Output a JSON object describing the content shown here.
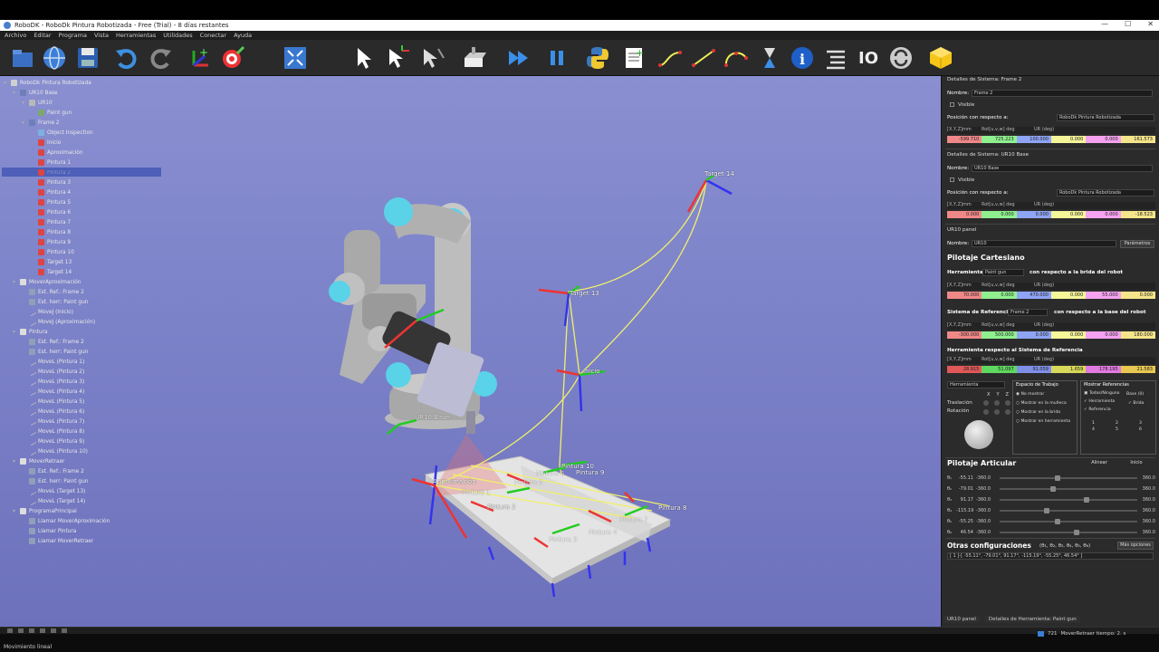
{
  "window": {
    "title": "RoboDK - RoboDk Pintura Robotizada - Free (Trial) - 8 días restantes",
    "controls": [
      "—",
      "☐",
      "✕"
    ]
  },
  "menu": [
    "Archivo",
    "Editar",
    "Programa",
    "Vista",
    "Herramientas",
    "Utilidades",
    "Conectar",
    "Ayuda"
  ],
  "toolbar": {
    "icons": [
      "open-icon",
      "globe-icon",
      "save-icon",
      "undo-icon",
      "redo-icon",
      "add-frame-icon",
      "add-target-icon",
      "fit-view-icon",
      "select-icon",
      "move-ref-icon",
      "move-tool-icon",
      "add-object-icon",
      "run-fast-icon",
      "pause-icon",
      "python-icon",
      "add-program-icon",
      "move-joint-icon",
      "move-linear-icon",
      "move-circular-icon",
      "pause-instruction-icon",
      "info-icon",
      "list-icon",
      "io-icon",
      "refresh-icon",
      "cube-icon"
    ],
    "io_label": "IO"
  },
  "tree": [
    {
      "label": "RoboDk Pintura Robotizada",
      "icon": "station",
      "level": 0,
      "twisty": "▾"
    },
    {
      "label": "UR10 Base",
      "icon": "frame",
      "level": 1,
      "twisty": "▾"
    },
    {
      "label": "UR10",
      "icon": "robot",
      "level": 2,
      "twisty": "▾"
    },
    {
      "label": "Paint gun",
      "icon": "tool",
      "level": 3,
      "twisty": ""
    },
    {
      "label": "Frame 2",
      "icon": "frame",
      "level": 2,
      "twisty": "▾"
    },
    {
      "label": "Object Inspection",
      "icon": "object",
      "level": 3,
      "twisty": ""
    },
    {
      "label": "Inicio",
      "icon": "target",
      "level": 3,
      "twisty": ""
    },
    {
      "label": "Aproximación",
      "icon": "target",
      "level": 3,
      "twisty": ""
    },
    {
      "label": "Pintura 1",
      "icon": "target",
      "level": 3,
      "twisty": ""
    },
    {
      "label": "Pintura 2",
      "icon": "target",
      "level": 3,
      "twisty": ""
    },
    {
      "label": "Pintura 3",
      "icon": "target",
      "level": 3,
      "twisty": ""
    },
    {
      "label": "Pintura 4",
      "icon": "target",
      "level": 3,
      "twisty": ""
    },
    {
      "label": "Pintura 5",
      "icon": "target",
      "level": 3,
      "twisty": ""
    },
    {
      "label": "Pintura 6",
      "icon": "target",
      "level": 3,
      "twisty": ""
    },
    {
      "label": "Pintura 7",
      "icon": "target",
      "level": 3,
      "twisty": ""
    },
    {
      "label": "Pintura 8",
      "icon": "target",
      "level": 3,
      "twisty": ""
    },
    {
      "label": "Pintura 9",
      "icon": "target",
      "level": 3,
      "twisty": ""
    },
    {
      "label": "Pintura 10",
      "icon": "target",
      "level": 3,
      "twisty": ""
    },
    {
      "label": "Target 13",
      "icon": "target",
      "level": 3,
      "twisty": ""
    },
    {
      "label": "Target 14",
      "icon": "target",
      "level": 3,
      "twisty": ""
    },
    {
      "label": "MoverAproximación",
      "icon": "prog",
      "level": 1,
      "twisty": "▾"
    },
    {
      "label": "Est. Ref.: Frame 2",
      "icon": "instr",
      "level": 2,
      "twisty": ""
    },
    {
      "label": "Est. herr: Paint gun",
      "icon": "instr",
      "level": 2,
      "twisty": ""
    },
    {
      "label": "MoveJ (Inicio)",
      "icon": "move",
      "level": 2,
      "twisty": ""
    },
    {
      "label": "MoveJ (Aproximación)",
      "icon": "move",
      "level": 2,
      "twisty": ""
    },
    {
      "label": "Pintura",
      "icon": "prog",
      "level": 1,
      "twisty": "▾"
    },
    {
      "label": "Est. Ref.: Frame 2",
      "icon": "instr",
      "level": 2,
      "twisty": ""
    },
    {
      "label": "Est. herr: Paint gun",
      "icon": "instr",
      "level": 2,
      "twisty": ""
    },
    {
      "label": "MoveL (Pintura 1)",
      "icon": "move",
      "level": 2,
      "twisty": ""
    },
    {
      "label": "MoveL (Pintura 2)",
      "icon": "move",
      "level": 2,
      "twisty": ""
    },
    {
      "label": "MoveL (Pintura 3)",
      "icon": "move",
      "level": 2,
      "twisty": ""
    },
    {
      "label": "MoveL (Pintura 4)",
      "icon": "move",
      "level": 2,
      "twisty": ""
    },
    {
      "label": "MoveL (Pintura 5)",
      "icon": "move",
      "level": 2,
      "twisty": ""
    },
    {
      "label": "MoveL (Pintura 6)",
      "icon": "move",
      "level": 2,
      "twisty": ""
    },
    {
      "label": "MoveL (Pintura 7)",
      "icon": "move",
      "level": 2,
      "twisty": ""
    },
    {
      "label": "MoveL (Pintura 8)",
      "icon": "move",
      "level": 2,
      "twisty": ""
    },
    {
      "label": "MoveL (Pintura 9)",
      "icon": "move",
      "level": 2,
      "twisty": ""
    },
    {
      "label": "MoveL (Pintura 10)",
      "icon": "move",
      "level": 2,
      "twisty": ""
    },
    {
      "label": "MoverRetraer",
      "icon": "prog",
      "level": 1,
      "twisty": "▾"
    },
    {
      "label": "Est. Ref.: Frame 2",
      "icon": "instr",
      "level": 2,
      "twisty": ""
    },
    {
      "label": "Est. herr: Paint gun",
      "icon": "instr",
      "level": 2,
      "twisty": ""
    },
    {
      "label": "MoveL (Target 13)",
      "icon": "move",
      "level": 2,
      "twisty": ""
    },
    {
      "label": "MoveL (Target 14)",
      "icon": "move",
      "level": 2,
      "twisty": ""
    },
    {
      "label": "ProgramaPrincipal",
      "icon": "prog",
      "level": 1,
      "twisty": "▾"
    },
    {
      "label": "Llamar MoverAproximación",
      "icon": "instr",
      "level": 2,
      "twisty": ""
    },
    {
      "label": "Llamar Pintura",
      "icon": "instr",
      "level": 2,
      "twisty": ""
    },
    {
      "label": "Llamar MoverRetraer",
      "icon": "instr",
      "level": 2,
      "twisty": ""
    }
  ],
  "viewport": {
    "labels": {
      "target14": "Target 14",
      "target13": "Target 13",
      "inicio": "Inicio",
      "pintura10": "Pintura 10",
      "pintura9": "Pintura 9",
      "pintura8": "Pintura 8",
      "pintura7": "Pintura 7",
      "pintura6": "Pintura 6",
      "pintura5": "Pintura 5",
      "pintura4": "Pintura 4",
      "pintura3": "Pintura 3",
      "pintura2": "Pintura 2",
      "pintura1": "Pintura 1",
      "aproximacion": "Aproximación",
      "ur10base": "UR10 Base"
    }
  },
  "right_panel": {
    "frame_details": {
      "header": "Detalles de Sistema: Frame 2",
      "name_label": "Nombre:",
      "name_value": "Frame 2",
      "visible_label": "Visible",
      "pos_label": "Posición con respecto a:",
      "ref_value": "RoboDk Pintura Robotizada",
      "pose_header": [
        "[X,Y,Z]mm",
        "Rot[u,v,w] deg",
        "UR (deg)"
      ],
      "pose": [
        "-599.710",
        "725.223",
        "100.000",
        "0.000",
        "0.000",
        "161.573"
      ]
    },
    "base_details": {
      "header": "Detalles de Sistema: UR10 Base",
      "name_label": "Nombre:",
      "name_value": "UR10 Base",
      "visible_label": "Visible",
      "pos_label": "Posición con respecto a:",
      "ref_value": "RoboDk Pintura Robotizada",
      "pose_header": [
        "[X,Y,Z]mm",
        "Rot[u,v,w] deg",
        "UR (deg)"
      ],
      "pose": [
        "0.000",
        "0.000",
        "0.000",
        "0.000",
        "0.000",
        "-18.523"
      ]
    },
    "robot_panel": {
      "header": "UR10 panel",
      "name_label": "Nombre:",
      "name_value": "UR10",
      "params_button": "Parámetros",
      "cartesian_title": "Pilotaje Cartesiano",
      "tool_label": "Herramienta",
      "tool_value": "Paint gun",
      "tool_rel": "con respecto a la brida del robot",
      "tool_pose": [
        "70.000",
        "0.000",
        "470.000",
        "0.000",
        "55.000",
        "0.000"
      ],
      "ref_label": "Sistema de Referencia",
      "ref_value": "Frame 2",
      "ref_rel": "con respecto a la base del robot",
      "ref_pose": [
        "-300.000",
        "500.000",
        "0.000",
        "0.000",
        "0.000",
        "180.000"
      ],
      "tool_ref_label": "Herramienta respecto al Sistema de Referencia",
      "tool_ref_pose": [
        "28.915",
        "51.097",
        "91.059",
        "1.659",
        "178.195",
        "21.583"
      ],
      "jog_label": "Herramienta",
      "translation_label": "Traslación",
      "rotation_label": "Rotación",
      "axes": [
        "X",
        "Y",
        "Z"
      ],
      "workspace_title": "Espacio de Trabajo",
      "workspace_opts": [
        "No mostrar",
        "Mostrar en la muñeca",
        "Mostrar en la brida",
        "Mostrar en herramienta"
      ],
      "show_refs_title": "Mostrar Referencias",
      "show_refs_opts": [
        "Todos/Ninguno",
        "Herramienta",
        "Referencia"
      ],
      "base_label": "Base (0)",
      "brida_label": "Brida",
      "joint_numbers": [
        "1",
        "2",
        "3",
        "4",
        "5",
        "6"
      ],
      "joint_title": "Pilotaje Articular",
      "align_button": "Alinear",
      "home_button": "Inicio",
      "joints": [
        {
          "name": "θ₁",
          "value": "-55.11",
          "min": "-360.0",
          "max": "360.0",
          "fraction": 0.42
        },
        {
          "name": "θ₂",
          "value": "-79.01",
          "min": "-360.0",
          "max": "360.0",
          "fraction": 0.39
        },
        {
          "name": "θ₃",
          "value": "91.17",
          "min": "-360.0",
          "max": "360.0",
          "fraction": 0.63
        },
        {
          "name": "θ₄",
          "value": "-115.19",
          "min": "-360.0",
          "max": "360.0",
          "fraction": 0.34
        },
        {
          "name": "θ₅",
          "value": "-55.25",
          "min": "-360.0",
          "max": "360.0",
          "fraction": 0.42
        },
        {
          "name": "θ₆",
          "value": "46.54",
          "min": "-360.0",
          "max": "360.0",
          "fraction": 0.56
        }
      ],
      "other_configs_title": "Otras configuraciones",
      "other_configs_vars": "(θ₁, θ₂, θ₃, θ₄, θ₅, θ₆)",
      "more_options_button": "Más opciones",
      "config_value": "[ 1 ]-[ -55.11°,  -79.01°,  91.17°,  -115.19°,  -55.25°,  46.54° ]"
    },
    "tabs": [
      "UR10 panel",
      "Detalles de Herramienta: Paint gun"
    ]
  },
  "status": {
    "left": "Movimiento lineal",
    "count": "721",
    "program_status": "MoverRetraer tiempo: 2. s"
  },
  "colors": {
    "viewport_top": "#898fd0",
    "viewport_bottom": "#6d71bc",
    "path": "#f0f06a",
    "selection": "#4d5fb8"
  }
}
